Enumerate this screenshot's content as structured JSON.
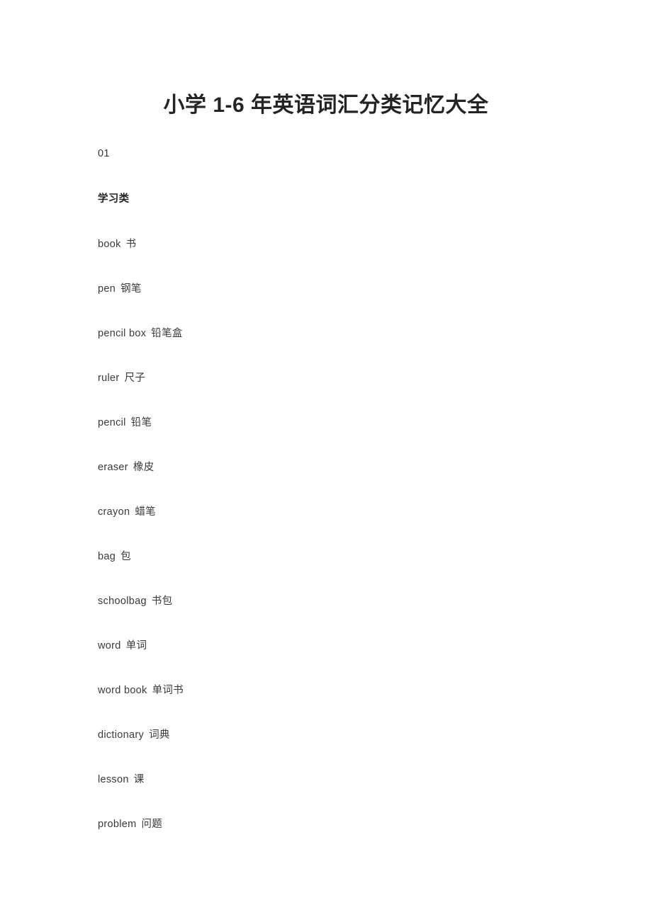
{
  "document": {
    "title": "小学 1-6 年英语词汇分类记忆大全",
    "background_color": "#ffffff",
    "text_color": "#3a3a3a",
    "title_color": "#242424"
  },
  "sections": [
    {
      "number": "01",
      "heading": "学习类",
      "entries": [
        {
          "en": "book",
          "zh": "书"
        },
        {
          "en": "pen",
          "zh": "钢笔"
        },
        {
          "en": "pencil box",
          "zh": "铅笔盒"
        },
        {
          "en": "ruler",
          "zh": "尺子"
        },
        {
          "en": "pencil",
          "zh": "铅笔"
        },
        {
          "en": "eraser",
          "zh": "橡皮"
        },
        {
          "en": "crayon",
          "zh": "蜡笔"
        },
        {
          "en": "bag",
          "zh": "包"
        },
        {
          "en": "schoolbag",
          "zh": "书包"
        },
        {
          "en": "word",
          "zh": "单词"
        },
        {
          "en": "word book",
          "zh": "单词书"
        },
        {
          "en": "dictionary",
          "zh": "词典"
        },
        {
          "en": "lesson",
          "zh": "课"
        },
        {
          "en": "problem",
          "zh": "问题"
        }
      ]
    }
  ]
}
